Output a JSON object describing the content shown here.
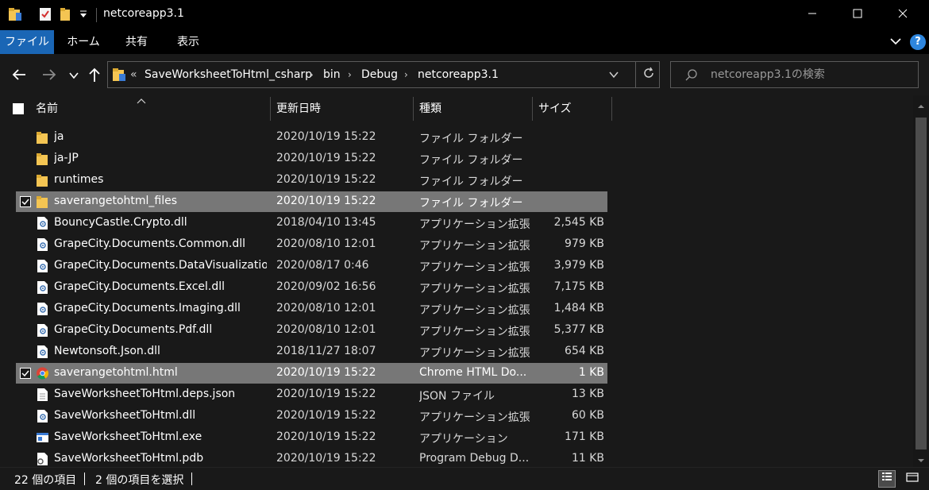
{
  "window": {
    "title": "netcoreapp3.1",
    "controls": {
      "minimize": "minimize-icon",
      "maximize": "maximize-icon",
      "close": "close-icon"
    }
  },
  "ribbon": {
    "tabs": [
      {
        "label": "ファイル",
        "active": true
      },
      {
        "label": "ホーム",
        "active": false
      },
      {
        "label": "共有",
        "active": false
      },
      {
        "label": "表示",
        "active": false
      }
    ],
    "help": "?"
  },
  "address": {
    "overflow": "«",
    "crumbs": [
      "SaveWorksheetToHtml_csharp",
      "bin",
      "Debug",
      "netcoreapp3.1"
    ],
    "search_placeholder": "netcoreapp3.1の検索"
  },
  "columns": {
    "name": "名前",
    "date": "更新日時",
    "type": "種類",
    "size": "サイズ"
  },
  "files": [
    {
      "name": "ja",
      "date": "2020/10/19 15:22",
      "type": "ファイル フォルダー",
      "size": "",
      "icon": "folder",
      "selected": false
    },
    {
      "name": "ja-JP",
      "date": "2020/10/19 15:22",
      "type": "ファイル フォルダー",
      "size": "",
      "icon": "folder",
      "selected": false
    },
    {
      "name": "runtimes",
      "date": "2020/10/19 15:22",
      "type": "ファイル フォルダー",
      "size": "",
      "icon": "folder",
      "selected": false
    },
    {
      "name": "saverangetohtml_files",
      "date": "2020/10/19 15:22",
      "type": "ファイル フォルダー",
      "size": "",
      "icon": "folder",
      "selected": true
    },
    {
      "name": "BouncyCastle.Crypto.dll",
      "date": "2018/04/10 13:45",
      "type": "アプリケーション拡張",
      "size": "2,545 KB",
      "icon": "dll",
      "selected": false
    },
    {
      "name": "GrapeCity.Documents.Common.dll",
      "date": "2020/08/10 12:01",
      "type": "アプリケーション拡張",
      "size": "979 KB",
      "icon": "dll",
      "selected": false
    },
    {
      "name": "GrapeCity.Documents.DataVisualizatio...",
      "date": "2020/08/17 0:46",
      "type": "アプリケーション拡張",
      "size": "3,979 KB",
      "icon": "dll",
      "selected": false
    },
    {
      "name": "GrapeCity.Documents.Excel.dll",
      "date": "2020/09/02 16:56",
      "type": "アプリケーション拡張",
      "size": "7,175 KB",
      "icon": "dll",
      "selected": false
    },
    {
      "name": "GrapeCity.Documents.Imaging.dll",
      "date": "2020/08/10 12:01",
      "type": "アプリケーション拡張",
      "size": "1,484 KB",
      "icon": "dll",
      "selected": false
    },
    {
      "name": "GrapeCity.Documents.Pdf.dll",
      "date": "2020/08/10 12:01",
      "type": "アプリケーション拡張",
      "size": "5,377 KB",
      "icon": "dll",
      "selected": false
    },
    {
      "name": "Newtonsoft.Json.dll",
      "date": "2018/11/27 18:07",
      "type": "アプリケーション拡張",
      "size": "654 KB",
      "icon": "dll",
      "selected": false
    },
    {
      "name": "saverangetohtml.html",
      "date": "2020/10/19 15:22",
      "type": "Chrome HTML Do...",
      "size": "1 KB",
      "icon": "chrome",
      "selected": true
    },
    {
      "name": "SaveWorksheetToHtml.deps.json",
      "date": "2020/10/19 15:22",
      "type": "JSON ファイル",
      "size": "13 KB",
      "icon": "file",
      "selected": false
    },
    {
      "name": "SaveWorksheetToHtml.dll",
      "date": "2020/10/19 15:22",
      "type": "アプリケーション拡張",
      "size": "60 KB",
      "icon": "dll",
      "selected": false
    },
    {
      "name": "SaveWorksheetToHtml.exe",
      "date": "2020/10/19 15:22",
      "type": "アプリケーション",
      "size": "171 KB",
      "icon": "exe",
      "selected": false
    },
    {
      "name": "SaveWorksheetToHtml.pdb",
      "date": "2020/10/19 15:22",
      "type": "Program Debug D...",
      "size": "11 KB",
      "icon": "pdb",
      "selected": false
    }
  ],
  "status": {
    "item_count": "22 個の項目",
    "selected_count": "2 個の項目を選択"
  },
  "colors": {
    "accent": "#1a66b5",
    "selection": "#777777",
    "background": "#191919",
    "folder": "#f4c553"
  }
}
